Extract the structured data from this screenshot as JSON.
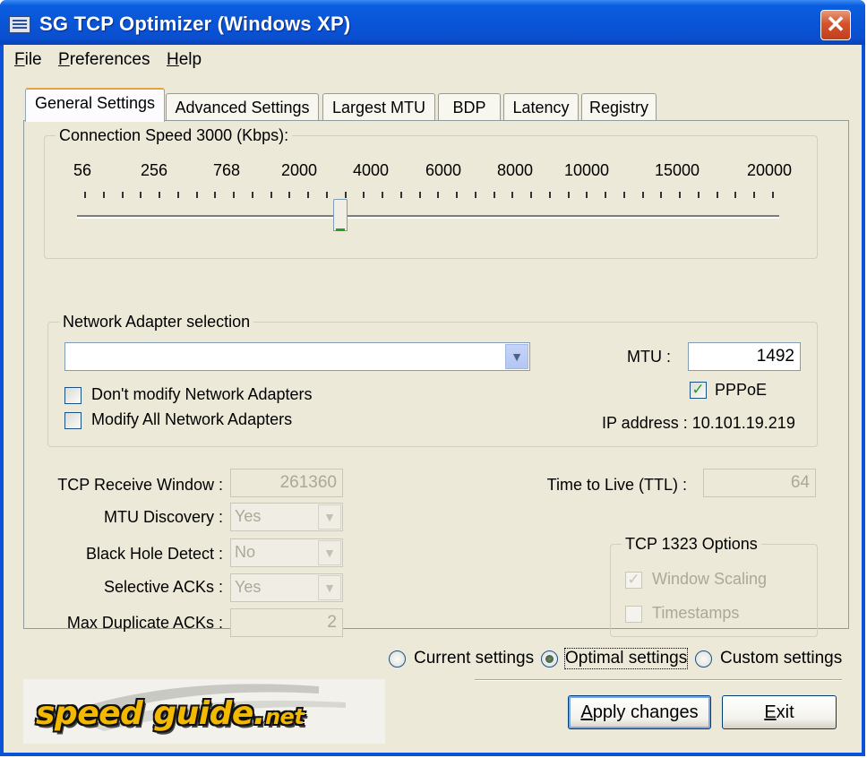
{
  "window": {
    "title": "SG TCP Optimizer (Windows XP)",
    "close_glyph": "✕"
  },
  "menu": [
    "File",
    "Preferences",
    "Help"
  ],
  "tabs": [
    "General Settings",
    "Advanced Settings",
    "Largest MTU",
    "BDP",
    "Latency",
    "Registry"
  ],
  "active_tab": "General Settings",
  "connection_speed": {
    "label": "Connection Speed  3000 (Kbps):",
    "value_kbps": 3000,
    "scale_labels": [
      "56",
      "256",
      "768",
      "2000",
      "4000",
      "6000",
      "8000",
      "10000",
      "15000",
      "20000"
    ],
    "slider_fraction": 0.375
  },
  "adapter": {
    "group_label": "Network Adapter selection",
    "selected": "",
    "dont_modify_label": "Don't modify Network Adapters",
    "dont_modify_checked": false,
    "modify_all_label": "Modify All Network Adapters",
    "modify_all_checked": false,
    "mtu_label": "MTU :",
    "mtu_value": "1492",
    "pppoe_label": "PPPoE",
    "pppoe_checked": true,
    "ip_text": "IP address : 10.101.19.219"
  },
  "tcp": {
    "receive_window_label": "TCP Receive Window :",
    "receive_window_value": "261360",
    "mtu_discovery_label": "MTU Discovery :",
    "mtu_discovery_value": "Yes",
    "black_hole_label": "Black Hole Detect :",
    "black_hole_value": "No",
    "selective_acks_label": "Selective ACKs :",
    "selective_acks_value": "Yes",
    "max_dup_label": "Max Duplicate ACKs :",
    "max_dup_value": "2",
    "ttl_label": "Time to Live (TTL) :",
    "ttl_value": "64"
  },
  "rfc1323": {
    "group_label": "TCP 1323 Options",
    "window_scaling_label": "Window Scaling",
    "window_scaling_checked": true,
    "timestamps_label": "Timestamps",
    "timestamps_checked": false
  },
  "mode": {
    "options": [
      "Current settings",
      "Optimal settings",
      "Custom settings"
    ],
    "selected": "Optimal settings"
  },
  "buttons": {
    "apply": "Apply changes",
    "exit": "Exit"
  },
  "logo": {
    "text": "speed guide",
    "suffix_dot": ".",
    "suffix": "net"
  },
  "colors": {
    "title_bar": "#0a55d7",
    "face": "#ece9d8",
    "check_green": "#21a121",
    "logo_yellow": "#f3b800"
  }
}
